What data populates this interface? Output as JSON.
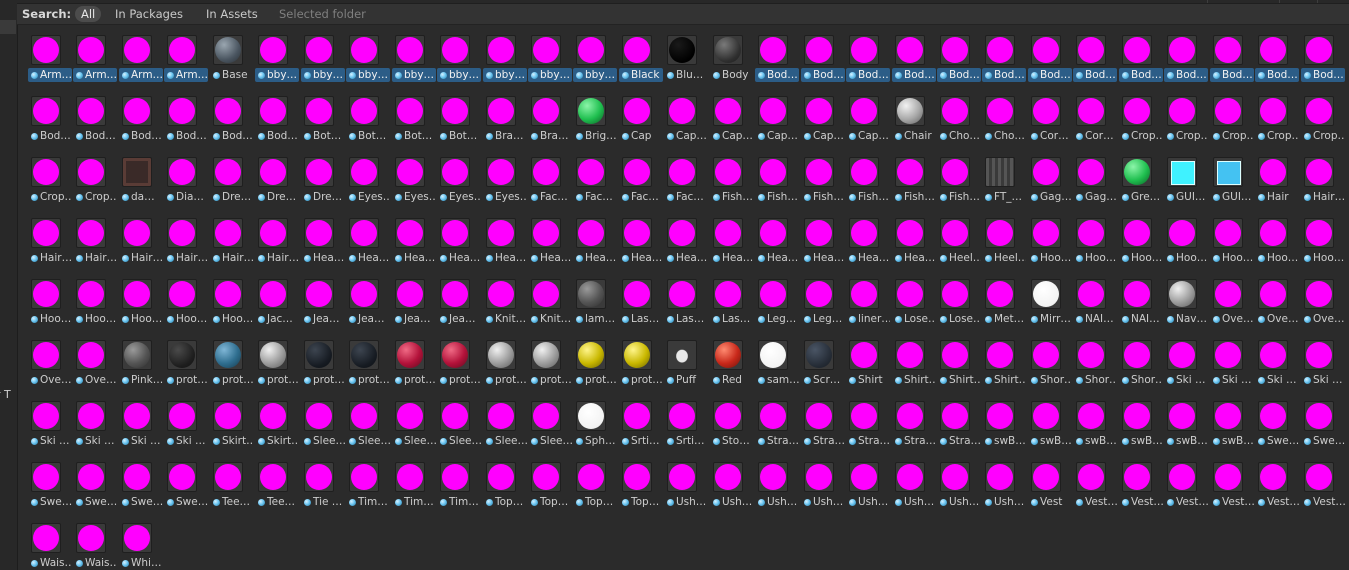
{
  "search": {
    "label": "Search:",
    "options": [
      "All",
      "In Packages",
      "In Assets",
      "Selected folder"
    ],
    "active": "All"
  },
  "left_panel_fragment": "r T",
  "colors": {
    "missing_shader_magenta": "#ff00ff",
    "selection_blue": "#2c5d87",
    "background": "#2b2b2b"
  },
  "items": [
    {
      "label": "Arm…",
      "c": "m",
      "sel": true
    },
    {
      "label": "Arm…",
      "c": "m",
      "sel": true
    },
    {
      "label": "Arm…",
      "c": "m",
      "sel": true
    },
    {
      "label": "Arm…",
      "c": "m",
      "sel": true
    },
    {
      "label": "Base",
      "c": "bluecheck"
    },
    {
      "label": "bby…",
      "c": "m",
      "sel": true
    },
    {
      "label": "bby…",
      "c": "m",
      "sel": true
    },
    {
      "label": "bby…",
      "c": "m",
      "sel": true
    },
    {
      "label": "bby…",
      "c": "m",
      "sel": true
    },
    {
      "label": "bby…",
      "c": "m",
      "sel": true
    },
    {
      "label": "bby…",
      "c": "m",
      "sel": true
    },
    {
      "label": "bby…",
      "c": "m",
      "sel": true
    },
    {
      "label": "bby…",
      "c": "m",
      "sel": true
    },
    {
      "label": "Black",
      "c": "m",
      "sel": true
    },
    {
      "label": "Blu…",
      "c": "black"
    },
    {
      "label": "Body",
      "c": "darkgrey"
    },
    {
      "label": "Bod…",
      "c": "m",
      "sel": true
    },
    {
      "label": "Bod…",
      "c": "m",
      "sel": true
    },
    {
      "label": "Bod…",
      "c": "m",
      "sel": true
    },
    {
      "label": "Bod…",
      "c": "m",
      "sel": true
    },
    {
      "label": "Bod…",
      "c": "m",
      "sel": true
    },
    {
      "label": "Bod…",
      "c": "m",
      "sel": true
    },
    {
      "label": "Bod…",
      "c": "m",
      "sel": true
    },
    {
      "label": "Bod…",
      "c": "m",
      "sel": true
    },
    {
      "label": "Bod…",
      "c": "m",
      "sel": true
    },
    {
      "label": "Bod…",
      "c": "m",
      "sel": true
    },
    {
      "label": "Bod…",
      "c": "m",
      "sel": true
    },
    {
      "label": "Bod…",
      "c": "m",
      "sel": true
    },
    {
      "label": "Bod…",
      "c": "m",
      "sel": true
    },
    {
      "label": "Bod…",
      "c": "m"
    },
    {
      "label": "Bod…",
      "c": "m"
    },
    {
      "label": "Bod…",
      "c": "m"
    },
    {
      "label": "Bod…",
      "c": "m"
    },
    {
      "label": "Bod…",
      "c": "m"
    },
    {
      "label": "Bod…",
      "c": "m"
    },
    {
      "label": "Bot…",
      "c": "m"
    },
    {
      "label": "Bot…",
      "c": "m"
    },
    {
      "label": "Bot…",
      "c": "m"
    },
    {
      "label": "Bot…",
      "c": "m"
    },
    {
      "label": "Bra…",
      "c": "m"
    },
    {
      "label": "Bra…",
      "c": "m"
    },
    {
      "label": "Brig…",
      "c": "green"
    },
    {
      "label": "Cap",
      "c": "m"
    },
    {
      "label": "Cap…",
      "c": "m"
    },
    {
      "label": "Cap…",
      "c": "m"
    },
    {
      "label": "Cap…",
      "c": "m"
    },
    {
      "label": "Cap…",
      "c": "m"
    },
    {
      "label": "Cap…",
      "c": "m"
    },
    {
      "label": "Chair",
      "c": "lightgrey"
    },
    {
      "label": "Cho…",
      "c": "m"
    },
    {
      "label": "Cho…",
      "c": "m"
    },
    {
      "label": "Cor…",
      "c": "m"
    },
    {
      "label": "Cor…",
      "c": "m"
    },
    {
      "label": "Crop…",
      "c": "m"
    },
    {
      "label": "Crop…",
      "c": "m"
    },
    {
      "label": "Crop…",
      "c": "m"
    },
    {
      "label": "Crop…",
      "c": "m"
    },
    {
      "label": "Crop…",
      "c": "m"
    },
    {
      "label": "Crop…",
      "c": "m"
    },
    {
      "label": "Crop…",
      "c": "m"
    },
    {
      "label": "da…",
      "c": "darktex"
    },
    {
      "label": "Dia…",
      "c": "m"
    },
    {
      "label": "Dre…",
      "c": "m"
    },
    {
      "label": "Dre…",
      "c": "m"
    },
    {
      "label": "Dre…",
      "c": "m"
    },
    {
      "label": "Eyes…",
      "c": "m"
    },
    {
      "label": "Eyes…",
      "c": "m"
    },
    {
      "label": "Eyes…",
      "c": "m"
    },
    {
      "label": "Eyes…",
      "c": "m"
    },
    {
      "label": "Fac…",
      "c": "m"
    },
    {
      "label": "Fac…",
      "c": "m"
    },
    {
      "label": "Fac…",
      "c": "m"
    },
    {
      "label": "Fac…",
      "c": "m"
    },
    {
      "label": "Fish…",
      "c": "m"
    },
    {
      "label": "Fish…",
      "c": "m"
    },
    {
      "label": "Fish…",
      "c": "m"
    },
    {
      "label": "Fish…",
      "c": "m"
    },
    {
      "label": "Fish…",
      "c": "m"
    },
    {
      "label": "Fish…",
      "c": "m"
    },
    {
      "label": "FT_…",
      "c": "fttex"
    },
    {
      "label": "Gag…",
      "c": "m"
    },
    {
      "label": "Gag…",
      "c": "m"
    },
    {
      "label": "Gre…",
      "c": "green"
    },
    {
      "label": "GUI…",
      "c": "cyan"
    },
    {
      "label": "GUI…",
      "c": "skyblue"
    },
    {
      "label": "Hair",
      "c": "m"
    },
    {
      "label": "Hair…",
      "c": "m"
    },
    {
      "label": "Hair…",
      "c": "m"
    },
    {
      "label": "Hair…",
      "c": "m"
    },
    {
      "label": "Hair…",
      "c": "m"
    },
    {
      "label": "Hair…",
      "c": "m"
    },
    {
      "label": "Hair…",
      "c": "m"
    },
    {
      "label": "Hair…",
      "c": "m"
    },
    {
      "label": "Hea…",
      "c": "m"
    },
    {
      "label": "Hea…",
      "c": "m"
    },
    {
      "label": "Hea…",
      "c": "m"
    },
    {
      "label": "Hea…",
      "c": "m"
    },
    {
      "label": "Hea…",
      "c": "m"
    },
    {
      "label": "Hea…",
      "c": "m"
    },
    {
      "label": "Hea…",
      "c": "m"
    },
    {
      "label": "Hea…",
      "c": "m"
    },
    {
      "label": "Hea…",
      "c": "m"
    },
    {
      "label": "Hea…",
      "c": "m"
    },
    {
      "label": "Hea…",
      "c": "m"
    },
    {
      "label": "Hea…",
      "c": "m"
    },
    {
      "label": "Hea…",
      "c": "m"
    },
    {
      "label": "Hea…",
      "c": "m"
    },
    {
      "label": "Heel…",
      "c": "m"
    },
    {
      "label": "Heel…",
      "c": "m"
    },
    {
      "label": "Hoo…",
      "c": "m"
    },
    {
      "label": "Hoo…",
      "c": "m"
    },
    {
      "label": "Hoo…",
      "c": "m"
    },
    {
      "label": "Hoo…",
      "c": "m"
    },
    {
      "label": "Hoo…",
      "c": "m"
    },
    {
      "label": "Hoo…",
      "c": "m"
    },
    {
      "label": "Hoo…",
      "c": "m"
    },
    {
      "label": "Hoo…",
      "c": "m"
    },
    {
      "label": "Hoo…",
      "c": "m"
    },
    {
      "label": "Hoo…",
      "c": "m"
    },
    {
      "label": "Hoo…",
      "c": "m"
    },
    {
      "label": "Hoo…",
      "c": "m"
    },
    {
      "label": "Jac…",
      "c": "m"
    },
    {
      "label": "Jea…",
      "c": "m"
    },
    {
      "label": "Jea…",
      "c": "m"
    },
    {
      "label": "Jea…",
      "c": "m"
    },
    {
      "label": "Jea…",
      "c": "m"
    },
    {
      "label": "Knit…",
      "c": "m"
    },
    {
      "label": "Knit…",
      "c": "m"
    },
    {
      "label": "lam…",
      "c": "grey"
    },
    {
      "label": "Las…",
      "c": "m"
    },
    {
      "label": "Las…",
      "c": "m"
    },
    {
      "label": "Las…",
      "c": "m"
    },
    {
      "label": "Leg…",
      "c": "m"
    },
    {
      "label": "Leg…",
      "c": "m"
    },
    {
      "label": "liner…",
      "c": "m"
    },
    {
      "label": "Lose…",
      "c": "m"
    },
    {
      "label": "Lose…",
      "c": "m"
    },
    {
      "label": "Met…",
      "c": "m"
    },
    {
      "label": "Mirr…",
      "c": "white"
    },
    {
      "label": "NAI…",
      "c": "m"
    },
    {
      "label": "NAI…",
      "c": "m"
    },
    {
      "label": "Nav…",
      "c": "silver"
    },
    {
      "label": "Ove…",
      "c": "m"
    },
    {
      "label": "Ove…",
      "c": "m"
    },
    {
      "label": "Ove…",
      "c": "m"
    },
    {
      "label": "Ove…",
      "c": "m"
    },
    {
      "label": "Ove…",
      "c": "m"
    },
    {
      "label": "Pink…",
      "c": "grey"
    },
    {
      "label": "prot…",
      "c": "charcoal"
    },
    {
      "label": "prot…",
      "c": "steelblue"
    },
    {
      "label": "prot…",
      "c": "silver"
    },
    {
      "label": "prot…",
      "c": "navy"
    },
    {
      "label": "prot…",
      "c": "navy"
    },
    {
      "label": "prot…",
      "c": "crimson"
    },
    {
      "label": "prot…",
      "c": "crimson"
    },
    {
      "label": "prot…",
      "c": "silver"
    },
    {
      "label": "prot…",
      "c": "silver"
    },
    {
      "label": "prot…",
      "c": "yellow"
    },
    {
      "label": "prot…",
      "c": "yellow"
    },
    {
      "label": "Puff",
      "c": "puff"
    },
    {
      "label": "Red",
      "c": "red"
    },
    {
      "label": "sam…",
      "c": "white"
    },
    {
      "label": "Scr…",
      "c": "slate"
    },
    {
      "label": "Shirt",
      "c": "m"
    },
    {
      "label": "Shirt…",
      "c": "m"
    },
    {
      "label": "Shirt…",
      "c": "m"
    },
    {
      "label": "Shirt…",
      "c": "m"
    },
    {
      "label": "Shor…",
      "c": "m"
    },
    {
      "label": "Shor…",
      "c": "m"
    },
    {
      "label": "Shor…",
      "c": "m"
    },
    {
      "label": "Ski …",
      "c": "m"
    },
    {
      "label": "Ski …",
      "c": "m"
    },
    {
      "label": "Ski …",
      "c": "m"
    },
    {
      "label": "Ski …",
      "c": "m"
    },
    {
      "label": "Ski …",
      "c": "m"
    },
    {
      "label": "Ski …",
      "c": "m"
    },
    {
      "label": "Ski …",
      "c": "m"
    },
    {
      "label": "Ski …",
      "c": "m"
    },
    {
      "label": "Skirt…",
      "c": "m"
    },
    {
      "label": "Skirt…",
      "c": "m"
    },
    {
      "label": "Slee…",
      "c": "m"
    },
    {
      "label": "Slee…",
      "c": "m"
    },
    {
      "label": "Slee…",
      "c": "m"
    },
    {
      "label": "Slee…",
      "c": "m"
    },
    {
      "label": "Slee…",
      "c": "m"
    },
    {
      "label": "Slee…",
      "c": "m"
    },
    {
      "label": "Sph…",
      "c": "white"
    },
    {
      "label": "Srti…",
      "c": "m"
    },
    {
      "label": "Srti…",
      "c": "m"
    },
    {
      "label": "Sto…",
      "c": "m"
    },
    {
      "label": "Stra…",
      "c": "m"
    },
    {
      "label": "Stra…",
      "c": "m"
    },
    {
      "label": "Stra…",
      "c": "m"
    },
    {
      "label": "Stra…",
      "c": "m"
    },
    {
      "label": "Stra…",
      "c": "m"
    },
    {
      "label": "swB…",
      "c": "m"
    },
    {
      "label": "swB…",
      "c": "m"
    },
    {
      "label": "swB…",
      "c": "m"
    },
    {
      "label": "swB…",
      "c": "m"
    },
    {
      "label": "swB…",
      "c": "m"
    },
    {
      "label": "swB…",
      "c": "m"
    },
    {
      "label": "Swe…",
      "c": "m"
    },
    {
      "label": "Swe…",
      "c": "m"
    },
    {
      "label": "Swe…",
      "c": "m"
    },
    {
      "label": "Swe…",
      "c": "m"
    },
    {
      "label": "Swe…",
      "c": "m"
    },
    {
      "label": "Swe…",
      "c": "m"
    },
    {
      "label": "Tee…",
      "c": "m"
    },
    {
      "label": "Tee…",
      "c": "m"
    },
    {
      "label": "Tie …",
      "c": "m"
    },
    {
      "label": "Tim…",
      "c": "m"
    },
    {
      "label": "Tim…",
      "c": "m"
    },
    {
      "label": "Tim…",
      "c": "m"
    },
    {
      "label": "Top…",
      "c": "m"
    },
    {
      "label": "Top…",
      "c": "m"
    },
    {
      "label": "Top…",
      "c": "m"
    },
    {
      "label": "Top…",
      "c": "m"
    },
    {
      "label": "Ush…",
      "c": "m"
    },
    {
      "label": "Ush…",
      "c": "m"
    },
    {
      "label": "Ush…",
      "c": "m"
    },
    {
      "label": "Ush…",
      "c": "m"
    },
    {
      "label": "Ush…",
      "c": "m"
    },
    {
      "label": "Ush…",
      "c": "m"
    },
    {
      "label": "Ush…",
      "c": "m"
    },
    {
      "label": "Ush…",
      "c": "m"
    },
    {
      "label": "Vest",
      "c": "m"
    },
    {
      "label": "Vest…",
      "c": "m"
    },
    {
      "label": "Vest…",
      "c": "m"
    },
    {
      "label": "Vest…",
      "c": "m"
    },
    {
      "label": "Vest…",
      "c": "m"
    },
    {
      "label": "Vest…",
      "c": "m"
    },
    {
      "label": "Vest…",
      "c": "m"
    },
    {
      "label": "Wais…",
      "c": "m"
    },
    {
      "label": "Wais…",
      "c": "m"
    },
    {
      "label": "Whi…",
      "c": "m"
    }
  ]
}
